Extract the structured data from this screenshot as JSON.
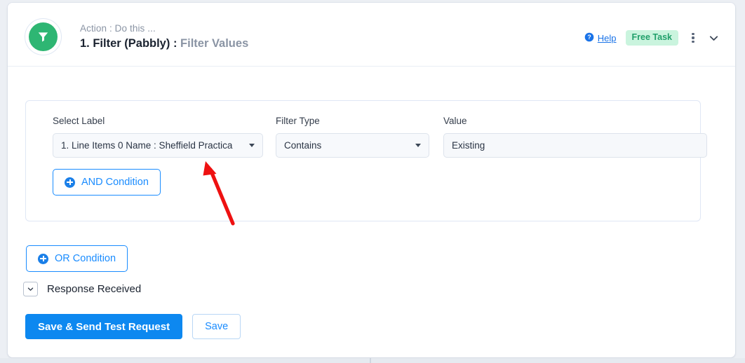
{
  "header": {
    "icon": "filter-funnel-icon",
    "eyebrow": "Action : Do this ...",
    "title_strong": "1. Filter (Pabbly) :",
    "title_sub": "Filter Values",
    "help_label": "Help",
    "help_icon": "question-circle-icon",
    "badge_label": "Free Task",
    "kebab_icon": "more-vertical-icon",
    "collapse_icon": "chevron-down-icon"
  },
  "condition": {
    "select_label": {
      "label": "Select Label",
      "value": "1. Line Items 0 Name : Sheffield Practica",
      "caret_icon": "caret-down-icon"
    },
    "filter_type": {
      "label": "Filter Type",
      "value": "Contains",
      "caret_icon": "caret-down-icon"
    },
    "value_field": {
      "label": "Value",
      "value": "Existing",
      "placeholder": "Value"
    },
    "and_button": {
      "label": "AND Condition",
      "icon": "plus-circle-icon"
    }
  },
  "or_button": {
    "label": "OR Condition",
    "icon": "plus-circle-icon"
  },
  "response": {
    "label": "Response Received",
    "toggle_icon": "chevron-down-icon"
  },
  "actions": {
    "primary_label": "Save & Send Test Request",
    "secondary_label": "Save"
  },
  "annotation": {
    "type": "arrow",
    "color": "#ee1111",
    "points_to": "select-label-dropdown"
  },
  "colors": {
    "brand_green": "#2eb673",
    "badge_bg": "#caf4de",
    "badge_text": "#22a06b",
    "link_blue": "#1a73e8",
    "primary_blue": "#0d88f0",
    "outline_blue": "#1a8cff",
    "page_bg": "#eceff4"
  }
}
